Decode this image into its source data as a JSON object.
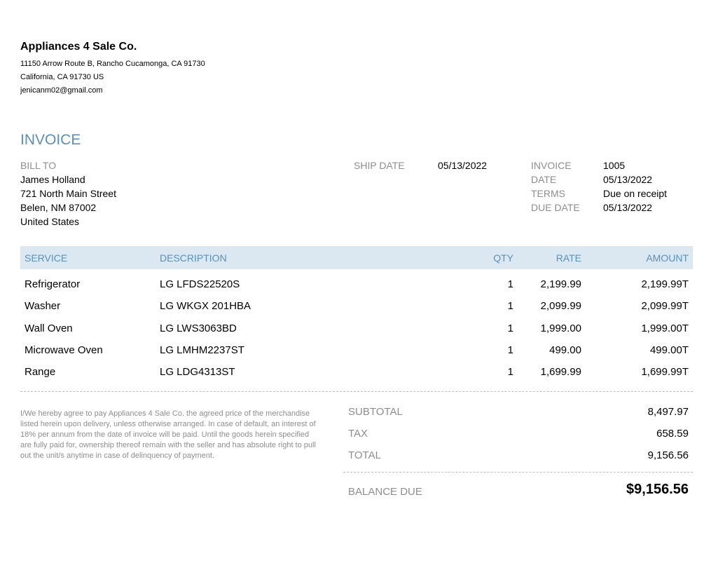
{
  "company": {
    "name": "Appliances 4 Sale Co.",
    "address_line1": "11150 Arrow Route B, Rancho Cucamonga, CA 91730",
    "address_line2": "California, CA  91730 US",
    "email": "jenicanm02@gmail.com"
  },
  "invoice_title": "INVOICE",
  "bill_to": {
    "label": "BILL TO",
    "name": "James Holland",
    "street": "721 North Main Street",
    "city": "Belen, NM 87002",
    "country": "United States"
  },
  "shipping": {
    "label": "SHIP DATE",
    "value": "05/13/2022"
  },
  "meta": {
    "invoice_label": "INVOICE",
    "invoice_value": "1005",
    "date_label": "DATE",
    "date_value": "05/13/2022",
    "terms_label": "TERMS",
    "terms_value": "Due on receipt",
    "due_label": "DUE DATE",
    "due_value": "05/13/2022"
  },
  "table": {
    "headers": {
      "service": "SERVICE",
      "description": "DESCRIPTION",
      "qty": "QTY",
      "rate": "RATE",
      "amount": "AMOUNT"
    },
    "rows": [
      {
        "service": "Refrigerator",
        "description": "LG LFDS22520S",
        "qty": "1",
        "rate": "2,199.99",
        "amount": "2,199.99T"
      },
      {
        "service": "Washer",
        "description": "LG WKGX 201HBA",
        "qty": "1",
        "rate": "2,099.99",
        "amount": "2,099.99T"
      },
      {
        "service": "Wall Oven",
        "description": "LG LWS3063BD",
        "qty": "1",
        "rate": "1,999.00",
        "amount": "1,999.00T"
      },
      {
        "service": "Microwave Oven",
        "description": "LG LMHM2237ST",
        "qty": "1",
        "rate": "499.00",
        "amount": "499.00T"
      },
      {
        "service": "Range",
        "description": "LG LDG4313ST",
        "qty": "1",
        "rate": "1,699.99",
        "amount": "1,699.99T"
      }
    ]
  },
  "terms_text": "I/We hereby agree to pay Appliances 4 Sale Co. the agreed price of the merchandise listed herein upon delivery, unless otherwise arranged. In case of default, an interest of 18% per annum from the date of invoice will be paid. Until the goods herein specified are fully paid for, ownership thereof remain with the seller and has absolute right to pull out the unit/s anytime in case of delinquency of payment.",
  "totals": {
    "subtotal_label": "SUBTOTAL",
    "subtotal_value": "8,497.97",
    "tax_label": "TAX",
    "tax_value": "658.59",
    "total_label": "TOTAL",
    "total_value": "9,156.56",
    "balance_label": "BALANCE DUE",
    "balance_value": "$9,156.56"
  },
  "colors": {
    "accent": "#5b8fb9",
    "header_bg": "#dce8f1",
    "muted": "#8e8e8e"
  }
}
